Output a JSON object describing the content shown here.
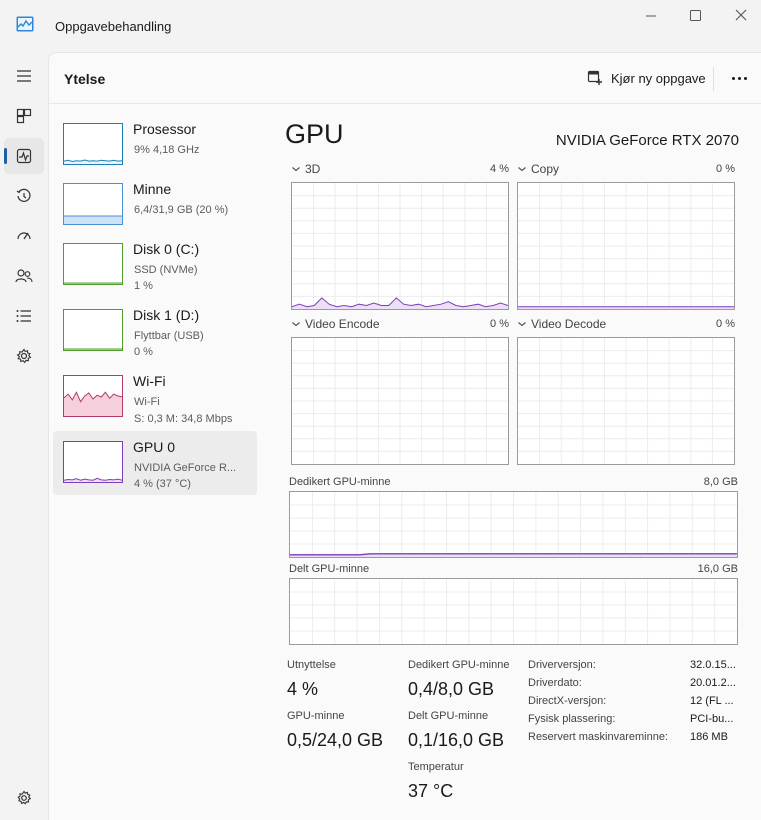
{
  "window": {
    "title": "Oppgavebehandling",
    "icon": "task-manager-icon",
    "controls": [
      "minimize-icon",
      "maximize-icon",
      "close-icon"
    ]
  },
  "nav": {
    "items": [
      {
        "icon": "hamburger-menu-icon"
      },
      {
        "icon": "processes-icon"
      },
      {
        "icon": "performance-icon",
        "active": true
      },
      {
        "icon": "app-history-icon"
      },
      {
        "icon": "startup-apps-icon"
      },
      {
        "icon": "users-icon"
      },
      {
        "icon": "details-icon"
      },
      {
        "icon": "services-icon"
      },
      {
        "icon": "settings-icon"
      }
    ]
  },
  "header": {
    "title": "Ytelse",
    "run_task_label": "Kjør ny oppgave",
    "run_task_icon": "new-task-icon",
    "more_icon": "more-icon"
  },
  "devices": [
    {
      "name": "Prosessor",
      "sub1": "9% 4,18 GHz",
      "sub2": "",
      "color": "#1c7fb3",
      "fill": "#e8f2f8"
    },
    {
      "name": "Minne",
      "sub1": "6,4/31,9 GB (20 %)",
      "sub2": "",
      "color": "#4a90d9",
      "fill": "#cde2f5",
      "level": 0.2
    },
    {
      "name": "Disk 0 (C:)",
      "sub1": "SSD (NVMe)",
      "sub2": "1 %",
      "color": "#4f9e2a",
      "fill": "#e6f2de"
    },
    {
      "name": "Disk 1 (D:)",
      "sub1": "Flyttbar (USB)",
      "sub2": "0 %",
      "color": "#4f9e2a",
      "fill": "#e6f2de"
    },
    {
      "name": "Wi-Fi",
      "sub1": "Wi-Fi",
      "sub2": "S: 0,3 M: 34,8 Mbps",
      "color": "#b33b6b",
      "fill": "#f6cfdc"
    },
    {
      "name": "GPU 0",
      "sub1": "NVIDIA GeForce R...",
      "sub2": "4 % (37 °C)",
      "color": "#7d3fb8",
      "fill": "#ebe0f5",
      "selected": true
    }
  ],
  "gpu": {
    "title": "GPU",
    "model": "NVIDIA GeForce RTX 2070",
    "engines": [
      {
        "label": "3D",
        "pct": "4 %"
      },
      {
        "label": "Copy",
        "pct": "0 %"
      },
      {
        "label": "Video Encode",
        "pct": "0 %"
      },
      {
        "label": "Video Decode",
        "pct": "0 %"
      }
    ],
    "dedicated_memory": {
      "label": "Dedikert GPU-minne",
      "max": "8,0 GB",
      "level": 0.05
    },
    "shared_memory": {
      "label": "Delt GPU-minne",
      "max": "16,0 GB",
      "level": 0.0
    },
    "accent": "#7d3fb8",
    "accent_fill": "#ebe0f5"
  },
  "stats": {
    "utilization_label": "Utnyttelse",
    "utilization": "4 %",
    "dedicated_label": "Dedikert GPU-minne",
    "dedicated": "0,4/8,0 GB",
    "gpu_memory_label": "GPU-minne",
    "gpu_memory": "0,5/24,0 GB",
    "shared_label": "Delt GPU-minne",
    "shared": "0,1/16,0 GB",
    "temperature_label": "Temperatur",
    "temperature": "37 °C"
  },
  "details": [
    {
      "key": "Driverversjon:",
      "value": "32.0.15..."
    },
    {
      "key": "Driverdato:",
      "value": "20.01.2..."
    },
    {
      "key": "DirectX-versjon:",
      "value": "12 (FL ..."
    },
    {
      "key": "Fysisk plassering:",
      "value": "PCI-bu..."
    },
    {
      "key": "Reservert maskinvareminne:",
      "value": "186 MB"
    }
  ]
}
